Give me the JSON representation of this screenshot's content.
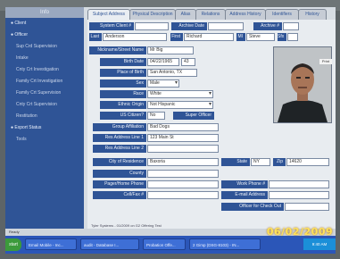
{
  "sidebar": {
    "header": "Info",
    "items": [
      {
        "label": "Client",
        "sub": false
      },
      {
        "label": "Officer",
        "sub": false
      },
      {
        "label": "Sup Crd Supervision",
        "sub": true
      },
      {
        "label": "Intake",
        "sub": true
      },
      {
        "label": "Cnty Crt Investigation",
        "sub": true
      },
      {
        "label": "Family Crt Investigation",
        "sub": true
      },
      {
        "label": "Family Crt Supervision",
        "sub": true
      },
      {
        "label": "Cnty Crt Supervision",
        "sub": true
      },
      {
        "label": "Restitution",
        "sub": true
      },
      {
        "label": "Export Status",
        "sub": false
      },
      {
        "label": "Tools",
        "sub": true
      }
    ]
  },
  "tabs": [
    "Subject Address",
    "Physical Description",
    "Alias",
    "Relations",
    "Address History",
    "Identifiers",
    "History"
  ],
  "form": {
    "system_client_label": "System Client #",
    "archive_date_label": "Archive Date",
    "archive_label": "Archive #",
    "last_label": "Last",
    "last_value": "Anderson",
    "first_label": "First",
    "first_value": "Richard",
    "mi_label": "MI",
    "mi_value": "Steve",
    "sfx_label": "Sfx",
    "nickname_label": "Nickname/Street Name",
    "nickname_value": "Mr Big",
    "birth_date_label": "Birth Date",
    "birth_date_value": "04/22/1965",
    "age_value": "43",
    "place_of_birth_label": "Place of Birth",
    "place_of_birth_value": "San Antonio, TX",
    "sex_label": "Sex",
    "sex_value": "Male",
    "race_label": "Race",
    "race_value": "White",
    "ethnic_origin_label": "Ethnic Origin",
    "ethnic_origin_value": "Not Hispanic",
    "us_citizen_label": "US Citizen?",
    "us_citizen_value": "No",
    "super_officer_label": "Super Officer",
    "group_affiliation_label": "Group Affiliation",
    "group_affiliation_value": "Bad Dogs",
    "res_address1_label": "Res Address Line 1",
    "res_address1_value": "123 Main St",
    "res_address2_label": "Res Address Line 2",
    "res_address2_value": "",
    "city_label": "City of Residence",
    "city_value": "Baxoria",
    "state_label": "State",
    "state_value": "NY",
    "zip_label": "Zip",
    "zip_value": "14620",
    "county_label": "County",
    "county_value": "",
    "pager_label": "Pager/Home Phone",
    "pager_value": "",
    "cell_label": "Cell/Fax #",
    "cell_value": "",
    "work_phone_label": "Work Phone #",
    "email_label": "E-mail Address",
    "officer_checkout_label": "Officer for Check Out",
    "photo_caption": "Print",
    "footer_note": "Tyler Systems - 01/2009 on G2 Offering Test"
  },
  "status_line": "Ready",
  "taskbar": {
    "start": "start",
    "tasks": [
      "Email Mobile - Inc...",
      "audit - Database I...",
      "Probation Offe...",
      "2 Gimp (DSG-8103) - IN..."
    ],
    "clock": "9:40 AM"
  },
  "photo_timestamp": "06/02/2009"
}
